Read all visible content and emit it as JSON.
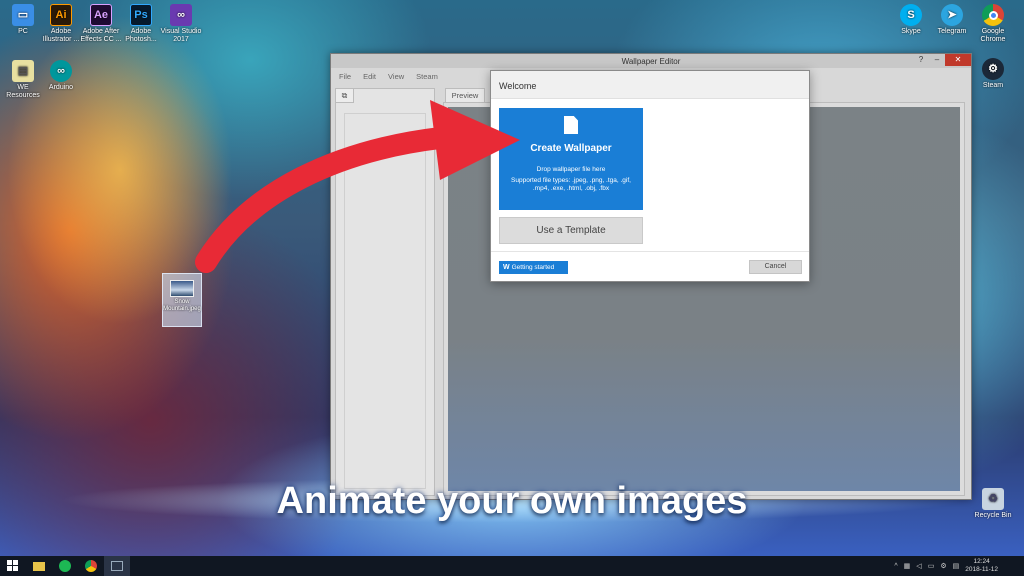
{
  "desktop": {
    "left_icons": [
      {
        "label": "PC",
        "glyph": "",
        "color": "#3a8ee6",
        "icon": "computer-icon"
      },
      {
        "label": "Adobe Illustrator ...",
        "glyph": "Ai",
        "color": "#2b1a08",
        "fg": "#ff9a00",
        "icon": "illustrator-icon"
      },
      {
        "label": "Adobe After Effects CC ...",
        "glyph": "Ae",
        "color": "#1f0b33",
        "fg": "#d8a0ff",
        "icon": "after-effects-icon"
      },
      {
        "label": "Adobe Photosh...",
        "glyph": "Ps",
        "color": "#061a2e",
        "fg": "#31a8ff",
        "icon": "photoshop-icon"
      },
      {
        "label": "Visual Studio 2017",
        "glyph": "",
        "color": "#6a3ab0",
        "icon": "visual-studio-icon"
      },
      {
        "label": "WE Resources",
        "glyph": "",
        "color": "#e8e0a0",
        "icon": "folder-icon"
      },
      {
        "label": "Arduino",
        "glyph": "",
        "color": "#00979c",
        "icon": "arduino-icon"
      }
    ],
    "right_icons": [
      {
        "label": "Skype",
        "color": "#00aff0",
        "icon": "skype-icon"
      },
      {
        "label": "Telegram",
        "color": "#2ca5e0",
        "icon": "telegram-icon"
      },
      {
        "label": "Google Chrome",
        "color": "#f4c20d",
        "icon": "chrome-icon"
      },
      {
        "label": "Steam",
        "color": "#1b2838",
        "icon": "steam-icon"
      },
      {
        "label": "Recycle Bin",
        "color": "#c8d4e0",
        "icon": "recycle-bin-icon"
      }
    ],
    "dragged_file": {
      "label": "Snow Mountain.jpeg"
    }
  },
  "window": {
    "title": "Wallpaper Editor",
    "help": "?",
    "minimize": "–",
    "close": "✕",
    "menu": [
      "File",
      "Edit",
      "View",
      "Steam"
    ],
    "preview_tab": "Preview"
  },
  "dialog": {
    "title": "Welcome",
    "create_title": "Create Wallpaper",
    "create_hint": "Drop wallpaper file here",
    "create_types": "Supported file types: .jpeg, .png, .tga, .gif, .mp4, .exe, .html, .obj, .fbx",
    "template_label": "Use a Template",
    "getting_started_label": "Getting started",
    "getting_started_icon": "W",
    "cancel_label": "Cancel",
    "accent": "#1a7ed6"
  },
  "caption": "Animate your own images",
  "taskbar": {
    "clock_time": "12:24",
    "clock_date": "2018-11-12",
    "tray_chevron": "^"
  }
}
